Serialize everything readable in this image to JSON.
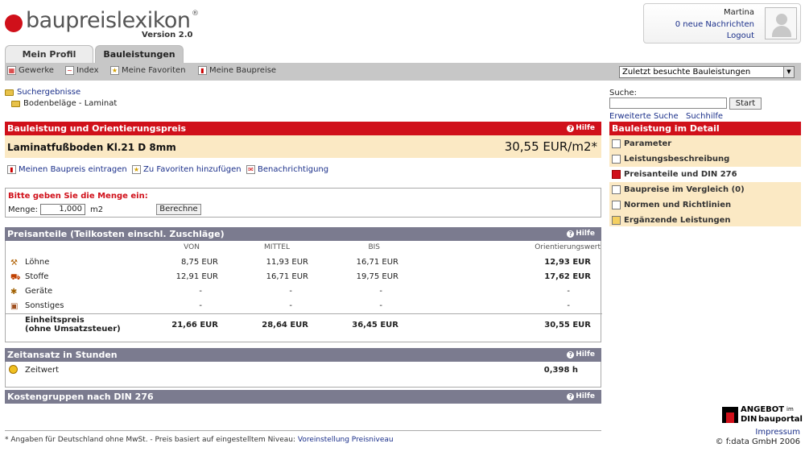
{
  "brand": {
    "name": "baupreislexikon",
    "reg": "®",
    "version": "Version 2.0",
    "brand_color": "#d0101a"
  },
  "user": {
    "name": "Martina",
    "messages": "0 neue Nachrichten",
    "logout": "Logout"
  },
  "tabs": [
    {
      "label": "Mein Profil"
    },
    {
      "label": "Bauleistungen"
    }
  ],
  "nav": {
    "items": [
      {
        "label": "Gewerke",
        "icon": "grid-icon"
      },
      {
        "label": "Index",
        "icon": "index-icon"
      },
      {
        "label": "Meine Favoriten",
        "icon": "star-icon"
      },
      {
        "label": "Meine Baupreise",
        "icon": "chart-icon"
      }
    ],
    "select_value": "Zuletzt besuchte Bauleistungen"
  },
  "breadcrumb": {
    "level1": "Suchergebnisse",
    "level2": "Bodenbeläge - Laminat"
  },
  "search": {
    "label": "Suche:",
    "button": "Start",
    "advanced": "Erweiterte Suche",
    "help": "Suchhilfe"
  },
  "hilfe": "Hilfe",
  "section1": {
    "title": "Bauleistung und Orientierungspreis",
    "item_name": "Laminatfußboden Kl.21 D 8mm",
    "price": "30,55 EUR/m2*",
    "actions": {
      "own_price": "Meinen Baupreis eintragen",
      "favorites": "Zu Favoriten hinzufügen",
      "notify": "Benachrichtigung"
    }
  },
  "quantity": {
    "prompt": "Bitte geben Sie die Menge ein:",
    "label": "Menge:",
    "value": "1,000",
    "unit": "m2",
    "button": "Berechne"
  },
  "preisanteile": {
    "title": "Preisanteile (Teilkosten einschl. Zuschläge)",
    "headers": {
      "von": "VON",
      "mittel": "MITTEL",
      "bis": "BIS",
      "ow": "Orientierungswert"
    },
    "rows": [
      {
        "label": "Löhne",
        "von": "8,75 EUR",
        "mittel": "11,93 EUR",
        "bis": "16,71 EUR",
        "ow": "12,93 EUR"
      },
      {
        "label": "Stoffe",
        "von": "12,91 EUR",
        "mittel": "16,71 EUR",
        "bis": "19,75 EUR",
        "ow": "17,62 EUR"
      },
      {
        "label": "Geräte",
        "von": "-",
        "mittel": "-",
        "bis": "-",
        "ow": "-"
      },
      {
        "label": "Sonstiges",
        "von": "-",
        "mittel": "-",
        "bis": "-",
        "ow": "-"
      }
    ],
    "total": {
      "label1": "Einheitspreis",
      "label2": "(ohne Umsatzsteuer)",
      "von": "21,66 EUR",
      "mittel": "28,64 EUR",
      "bis": "36,45 EUR",
      "ow": "30,55 EUR"
    }
  },
  "zeitansatz": {
    "title": "Zeitansatz in Stunden",
    "label": "Zeitwert",
    "value": "0,398 h"
  },
  "kostengruppen": {
    "title": "Kostengruppen nach DIN 276"
  },
  "sidebar": {
    "title": "Bauleistung im Detail",
    "items": [
      {
        "label": "Parameter"
      },
      {
        "label": "Leistungsbeschreibung"
      },
      {
        "label": "Preisanteile und DIN 276"
      },
      {
        "label": "Baupreise im Vergleich  (0)"
      },
      {
        "label": "Normen und Richtlinien"
      },
      {
        "label": "Ergänzende Leistungen"
      }
    ]
  },
  "footer": {
    "note": "* Angaben für Deutschland ohne MwSt. - Preis basiert auf eingestelltem Niveau:",
    "link": "Voreinstellung Preisniveau",
    "impressum": "Impressum",
    "copyright": "© f:data GmbH 2006"
  },
  "angebot": {
    "line1": "ANGEBOT",
    "line1b": "im",
    "line2": "DIN",
    "line2b": "bauportal"
  }
}
